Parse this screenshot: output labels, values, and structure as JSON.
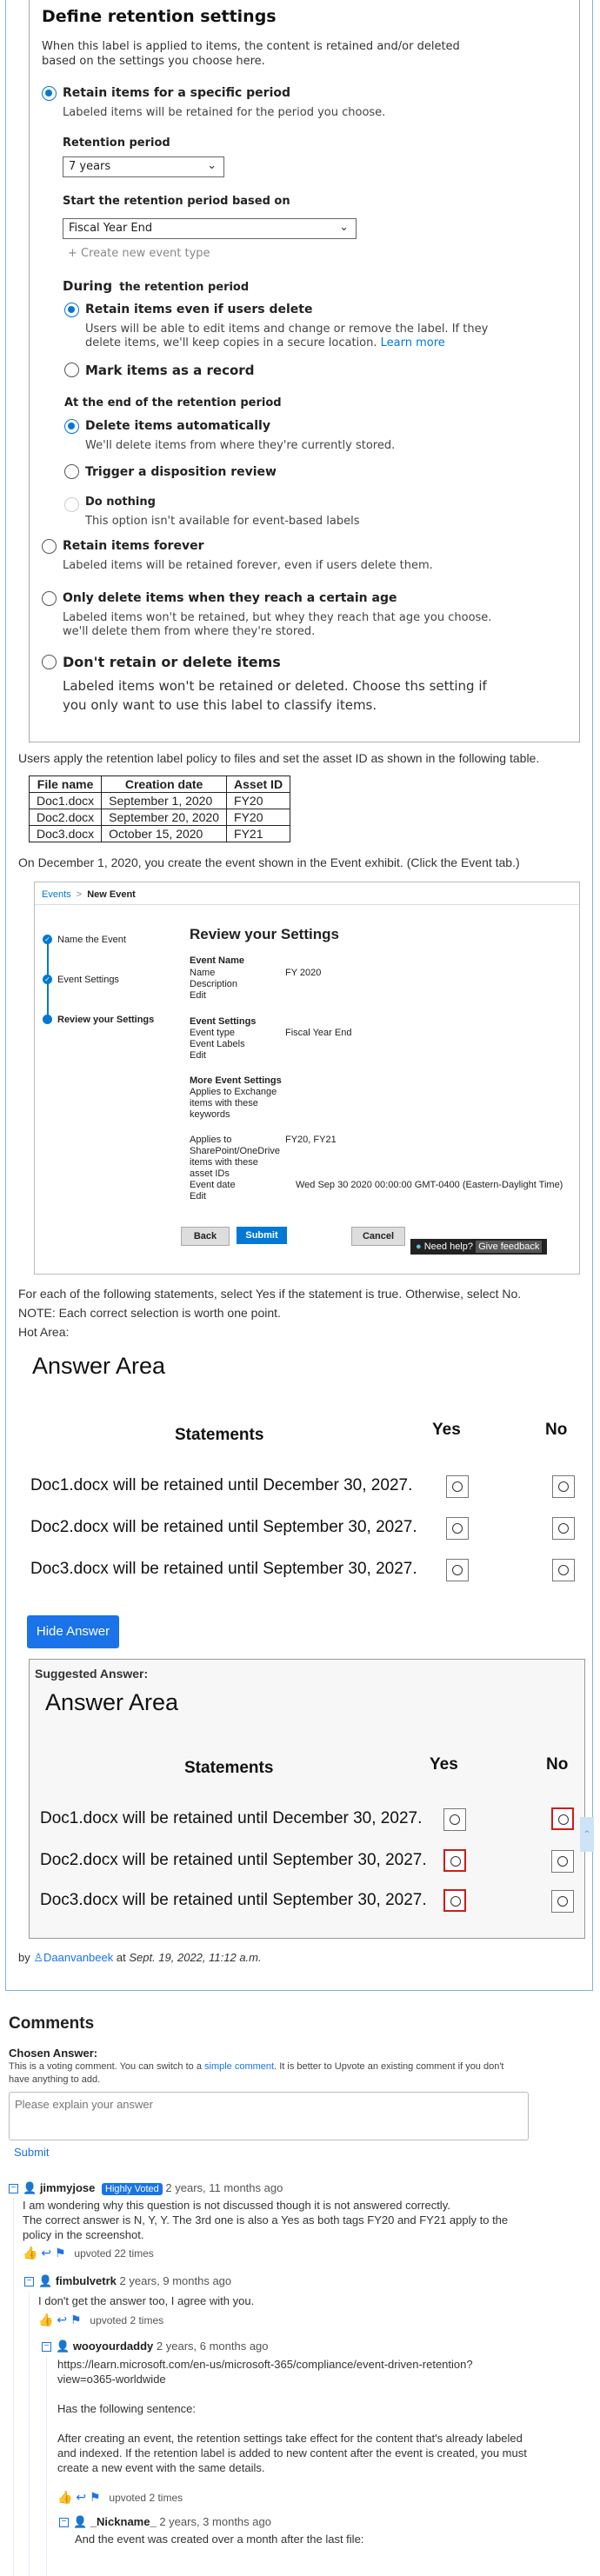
{
  "settings": {
    "title": "Define retention settings",
    "intro1": "When this label is applied to items, the content is retained and/or deleted",
    "intro2": "based on the settings you choose here.",
    "opt_retain_period": "Retain items for a specific period",
    "opt_retain_period_desc": "Labeled items will be retained for the period you choose.",
    "period_label": "Retention period",
    "period_value": "7 years",
    "start_label": "Start the retention period based on",
    "start_value": "Fiscal Year End",
    "create_event_type": "+  Create new event type",
    "during_bold": "During",
    "during_rest": "the retention period",
    "opt_retain_delete": "Retain items even if users delete",
    "opt_retain_delete_desc1": "Users will be able to edit items and change or remove the label. If they",
    "opt_retain_delete_desc2": "delete items, we'll keep copies in a secure location.",
    "learn_more": "Learn more",
    "opt_mark_record": "Mark items as a record",
    "end_label": "At the end of the retention period",
    "opt_delete_auto": "Delete items automatically",
    "opt_delete_auto_desc": "We'll delete items from where they're currently stored.",
    "opt_disposition": "Trigger a disposition review",
    "opt_do_nothing": "Do nothing",
    "opt_do_nothing_desc": "This option isn't available for event-based labels",
    "opt_retain_forever": "Retain items forever",
    "opt_retain_forever_desc": "Labeled items will be retained forever, even if users delete them.",
    "opt_delete_age": "Only delete items when they reach a certain age",
    "opt_delete_age_desc1": "Labeled items won't be retained, but whey they reach that age you choose.",
    "opt_delete_age_desc2": "we'll delete them from where they're stored.",
    "opt_dont_retain": "Don't retain or delete items",
    "opt_dont_retain_desc1": "Labeled items won't be retained or deleted. Choose ths setting if",
    "opt_dont_retain_desc2": "you only want to use this label to classify items."
  },
  "question": {
    "table_intro": "Users apply the retention label policy to files and set the asset ID as shown in the following table.",
    "headers": [
      "File name",
      "Creation date",
      "Asset ID"
    ],
    "rows": [
      [
        "Doc1.docx",
        "September 1, 2020",
        "FY20"
      ],
      [
        "Doc2.docx",
        "September 20, 2020",
        "FY20"
      ],
      [
        "Doc3.docx",
        "October 15, 2020",
        "FY21"
      ]
    ],
    "event_intro": "On December 1, 2020, you create the event shown in the Event exhibit. (Click the Event tab.)",
    "instruction": "For each of the following statements, select Yes if the statement is true. Otherwise, select No.",
    "note": "NOTE: Each correct selection is worth one point.",
    "hot_area": "Hot Area:"
  },
  "event": {
    "breadcrumb_root": "Events",
    "breadcrumb_sep": ">",
    "breadcrumb_current": "New Event",
    "steps": [
      "Name the Event",
      "Event Settings",
      "Review your Settings"
    ],
    "heading": "Review your Settings",
    "event_name_title": "Event Name",
    "name_label": "Name",
    "name_value": "FY 2020",
    "description_label": "Description",
    "edit": "Edit",
    "event_settings_title": "Event Settings",
    "event_type_label": "Event type",
    "event_type_value": "Fiscal Year End",
    "event_labels_label": "Event Labels",
    "more_title": "More Event Settings",
    "exchange_label": [
      "Applies to Exchange",
      "items with these",
      "keywords"
    ],
    "sharepoint_label": [
      "Applies to",
      "SharePoint/OneDrive",
      "items with these",
      "asset IDs"
    ],
    "sharepoint_value": "FY20, FY21",
    "event_date_label": "Event date",
    "event_date_value": "Wed Sep 30 2020 00:00:00 GMT-0400 (Eastern-Daylight Time)",
    "back": "Back",
    "submit": "Submit",
    "cancel": "Cancel",
    "help": "Need help?",
    "feedback": "Give feedback"
  },
  "answer_area": {
    "title": "Answer Area",
    "col_statements": "Statements",
    "col_yes": "Yes",
    "col_no": "No",
    "statements": [
      "Doc1.docx will be retained until December 30, 2027.",
      "Doc2.docx will be retained until September 30, 2027.",
      "Doc3.docx will be retained until September 30, 2027."
    ]
  },
  "hide_answer": "Hide Answer",
  "suggested": {
    "label": "Suggested Answer:",
    "selected": [
      "No",
      "Yes",
      "Yes"
    ]
  },
  "byline": {
    "by": "by",
    "author": "Daanvanbeek",
    "at": "at",
    "date": "Sept. 19, 2022, 11:12 a.m."
  },
  "comments": {
    "title": "Comments",
    "chosen_answer": "Chosen Answer:",
    "voting_note_pre": "This is a voting comment. You can switch to a",
    "voting_note_link": "simple comment",
    "voting_note_post": ". It is better to Upvote an existing comment if you don't",
    "voting_note_line2": "have anything to add.",
    "placeholder": "Please explain your answer",
    "submit": "Submit",
    "list": [
      {
        "author": "jimmyjose",
        "badge": "Highly Voted",
        "date": "2 years, 11 months ago",
        "lines": [
          "I am wondering why this question is not discussed though it is not answered correctly.",
          "The correct answer is N, Y, Y. The 3rd one is also a Yes as both tags FY20 and FY21 apply to the",
          "policy in the screenshot."
        ],
        "upvoted": "upvoted 22 times"
      },
      {
        "author": "fimbulvetrk",
        "date": "2 years, 9 months ago",
        "lines": [
          "I don't get the answer too, I agree with you."
        ],
        "upvoted": "upvoted 2 times"
      },
      {
        "author": "wooyourdaddy",
        "date": "2 years, 6 months ago",
        "lines": [
          "https://learn.microsoft.com/en-us/microsoft-365/compliance/event-driven-retention?",
          "view=o365-worldwide",
          "",
          "Has the following sentence:",
          "",
          "After creating an event, the retention settings take effect for the content that's already labeled",
          "and indexed. If the retention label is added to new content after the event is created, you must",
          "create a new event with the same details."
        ],
        "upvoted": "upvoted 2 times"
      },
      {
        "author": "_Nickname_",
        "date": "2 years, 3 months ago",
        "lines": [
          "And the event was created over a month after the last file:"
        ]
      }
    ]
  }
}
